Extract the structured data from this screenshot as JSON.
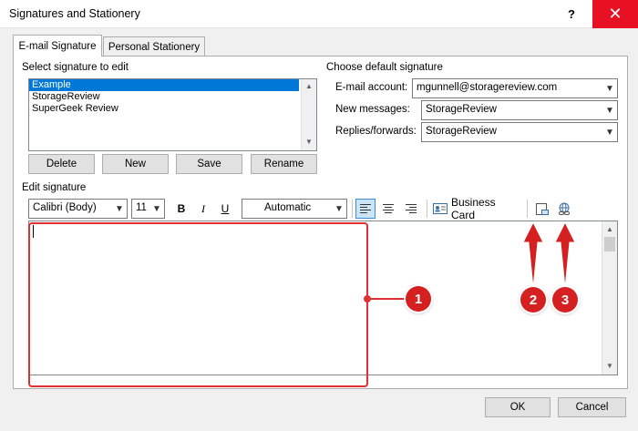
{
  "window": {
    "title": "Signatures and Stationery",
    "help": "?",
    "close": "✕"
  },
  "tabs": [
    {
      "label": "E-mail Signature",
      "active": true
    },
    {
      "label": "Personal Stationery",
      "active": false
    }
  ],
  "select_signature": {
    "label": "Select signature to edit",
    "items": [
      "Example",
      "StorageReview",
      "SuperGeek Review"
    ],
    "selected": "Example"
  },
  "buttons": {
    "delete": "Delete",
    "new": "New",
    "save": "Save",
    "rename": "Rename",
    "ok": "OK",
    "cancel": "Cancel"
  },
  "default_signature": {
    "label": "Choose default signature",
    "email_account_label": "E-mail account:",
    "email_account_value": "mgunnell@storagereview.com",
    "new_messages_label": "New messages:",
    "new_messages_value": "StorageReview",
    "replies_label": "Replies/forwards:",
    "replies_value": "StorageReview"
  },
  "edit_signature": {
    "label": "Edit signature",
    "font": "Calibri (Body)",
    "size": "11",
    "bold": "B",
    "italic": "I",
    "underline": "U",
    "color": "Automatic",
    "business_card": "Business Card",
    "editor_content": ""
  },
  "annotations": [
    "1",
    "2",
    "3"
  ],
  "colors": {
    "selection": "#0078d7",
    "close": "#e81123",
    "annotation": "#d42020"
  }
}
